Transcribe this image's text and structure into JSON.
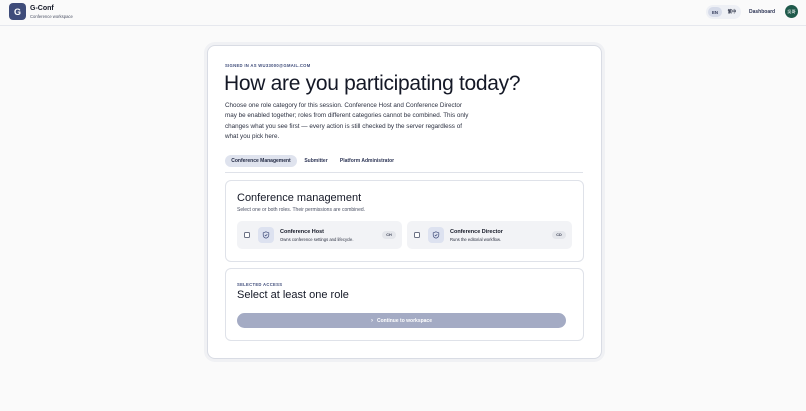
{
  "header": {
    "logo_letter": "G",
    "brand_name": "G-Conf",
    "brand_subtitle": "Conference workspace",
    "lang_options": [
      "EN",
      "繁中"
    ],
    "lang_selected": "EN",
    "dashboard_link": "Dashboard",
    "avatar_initials": "吳哥"
  },
  "main": {
    "signed_in": "SIGNED IN AS WU33000@GMAIL.COM",
    "heading": "How are you participating today?",
    "intro": "Choose one role category for this session. Conference Host and Conference Director may be enabled together; roles from different categories cannot be combined. This only changes what you see first — every action is still checked by the server regardless of what you pick here.",
    "tabs": [
      {
        "label": "Conference Management",
        "active": true
      },
      {
        "label": "Submitter",
        "active": false
      },
      {
        "label": "Platform Administrator",
        "active": false
      }
    ],
    "section": {
      "title": "Conference management",
      "hint": "Select one or both roles. Their permissions are combined.",
      "roles": [
        {
          "name": "Conference Host",
          "description": "Owns conference settings and lifecycle.",
          "badge": "CH",
          "checked": false,
          "icon": "shield-icon"
        },
        {
          "name": "Conference Director",
          "description": "Runs the editorial workflow.",
          "badge": "CD",
          "checked": false,
          "icon": "shield-icon"
        }
      ]
    },
    "access": {
      "label": "SELECTED ACCESS",
      "title": "Select at least one role",
      "button": "Continue to workspace",
      "button_enabled": false
    }
  },
  "colors": {
    "accent": "#3f4c7a",
    "avatar": "#1f5a4b",
    "button_disabled": "#a4abc4",
    "tab_active_bg": "#dfe3ee"
  }
}
